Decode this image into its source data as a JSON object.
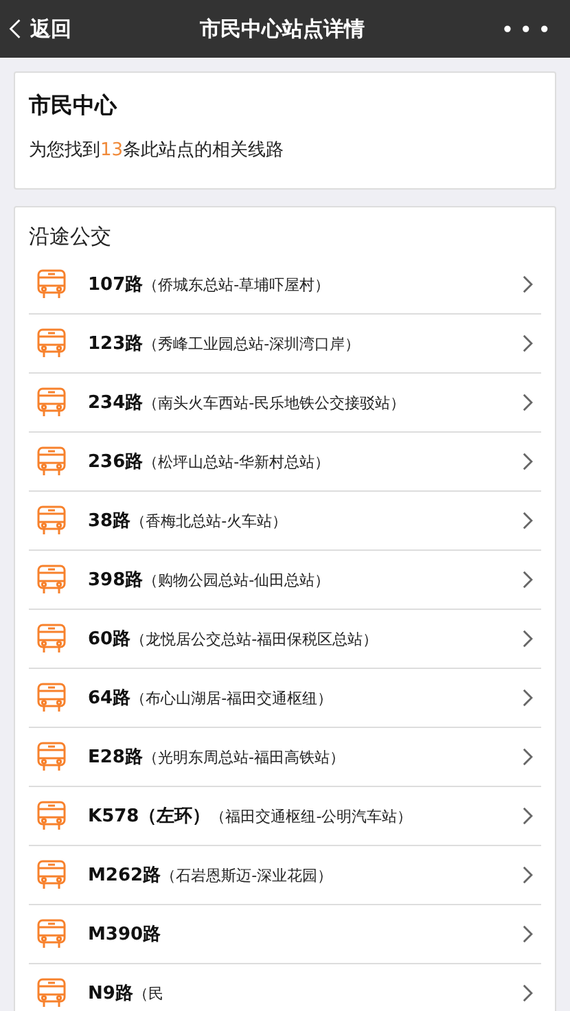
{
  "nav": {
    "back": "返回",
    "title": "市民中心站点详情",
    "more": "•••"
  },
  "stop": {
    "name": "市民中心",
    "summary_before": "为您找到",
    "count": "13",
    "summary_after": "条此站点的相关线路"
  },
  "routes_section": {
    "title": "沿途公交",
    "routes": [
      {
        "name": "107路",
        "stations": "（侨城东总站-草埔吓屋村）"
      },
      {
        "name": "123路",
        "stations": "（秀峰工业园总站-深圳湾口岸）"
      },
      {
        "name": "234路",
        "stations": "（南头火车西站-民乐地铁公交接驳站）"
      },
      {
        "name": "236路",
        "stations": "（松坪山总站-华新村总站）"
      },
      {
        "name": "38路",
        "stations": "（香梅北总站-火车站）"
      },
      {
        "name": "398路",
        "stations": "（购物公园总站-仙田总站）"
      },
      {
        "name": "60路",
        "stations": "（龙悦居公交总站-福田保税区总站）"
      },
      {
        "name": "64路",
        "stations": "（布心山湖居-福田交通枢纽）"
      },
      {
        "name": "E28路",
        "stations": "（光明东周总站-福田高铁站）"
      },
      {
        "name": "K578（左环）",
        "stations": "（福田交通枢纽-公明汽车站）"
      },
      {
        "name": "M262路",
        "stations": "（石岩恩斯迈-深业花园）"
      },
      {
        "name": "M390路"
      },
      {
        "name": "N9路",
        "stations": "（民"
      }
    ]
  }
}
